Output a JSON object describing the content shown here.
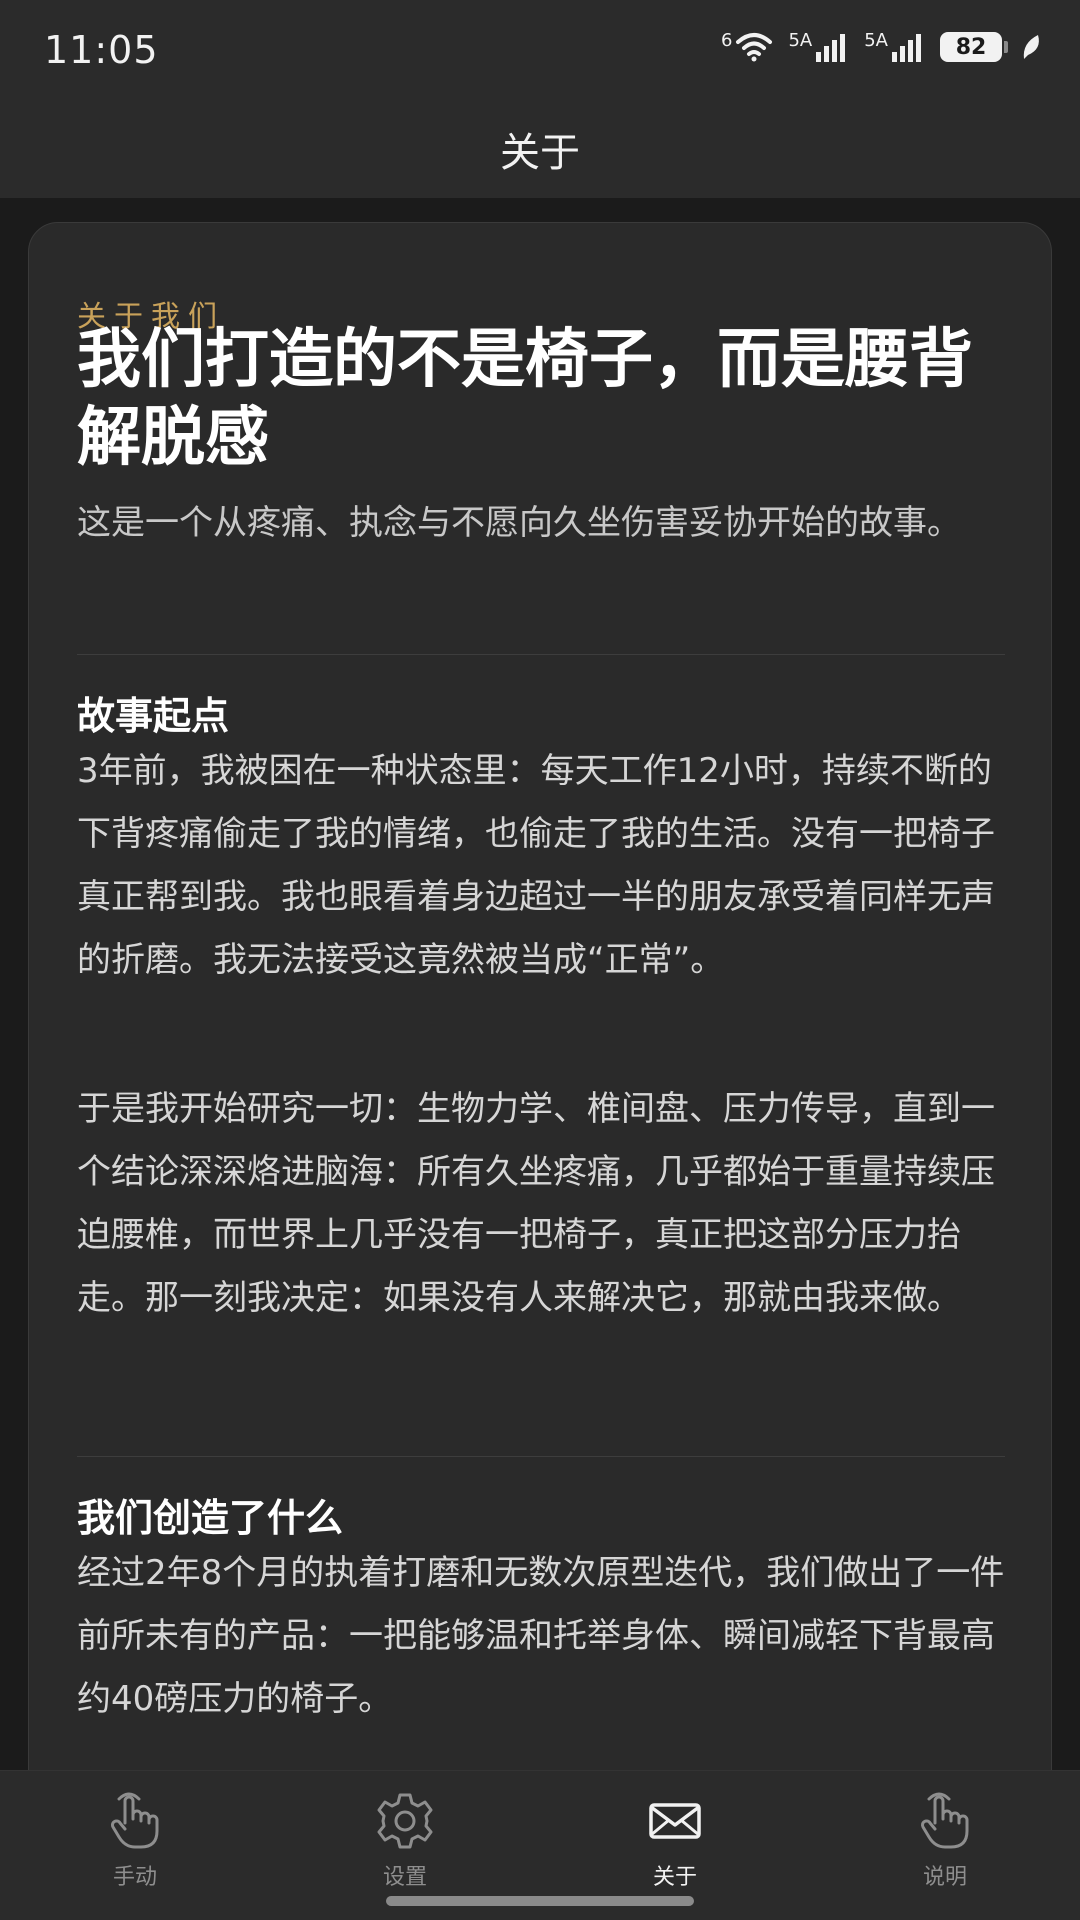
{
  "status_bar": {
    "time": "11:05",
    "wifi_label": "6",
    "signal1_label": "5A",
    "signal2_label": "5A",
    "battery": "82"
  },
  "header": {
    "title": "关于"
  },
  "card": {
    "eyebrow": "关于我们",
    "headline": "我们打造的不是椅子，而是腰背解脱感",
    "lead": "这是一个从疼痛、执念与不愿向久坐伤害妥协开始的故事。",
    "sections": [
      {
        "title": "故事起点",
        "paragraphs": [
          "3年前，我被困在一种状态里：每天工作12小时，持续不断的下背疼痛偷走了我的情绪，也偷走了我的生活。没有一把椅子真正帮到我。我也眼看着身边超过一半的朋友承受着同样无声的折磨。我无法接受这竟然被当成“正常”。",
          "于是我开始研究一切：生物力学、椎间盘、压力传导，直到一个结论深深烙进脑海：所有久坐疼痛，几乎都始于重量持续压迫腰椎，而世界上几乎没有一把椅子，真正把这部分压力抬走。那一刻我决定：如果没有人来解决它，那就由我来做。"
        ]
      },
      {
        "title": "我们创造了什么",
        "paragraphs": [
          "经过2年8个月的执着打磨和无数次原型迭代，我们做出了一件前所未有的产品：一把能够温和托举身体、瞬间减轻下背最高约40磅压力的椅子。"
        ]
      }
    ]
  },
  "tabs": [
    {
      "label": "手动",
      "icon": "hand-pointer-icon",
      "active": false
    },
    {
      "label": "设置",
      "icon": "gear-icon",
      "active": false
    },
    {
      "label": "关于",
      "icon": "mail-icon",
      "active": true
    },
    {
      "label": "说明",
      "icon": "hand-pointer-icon",
      "active": false
    }
  ],
  "colors": {
    "accent": "#c9a25a",
    "background": "#1b1b1b",
    "card": "#2a2a2a",
    "bar": "#2b2b2b"
  }
}
